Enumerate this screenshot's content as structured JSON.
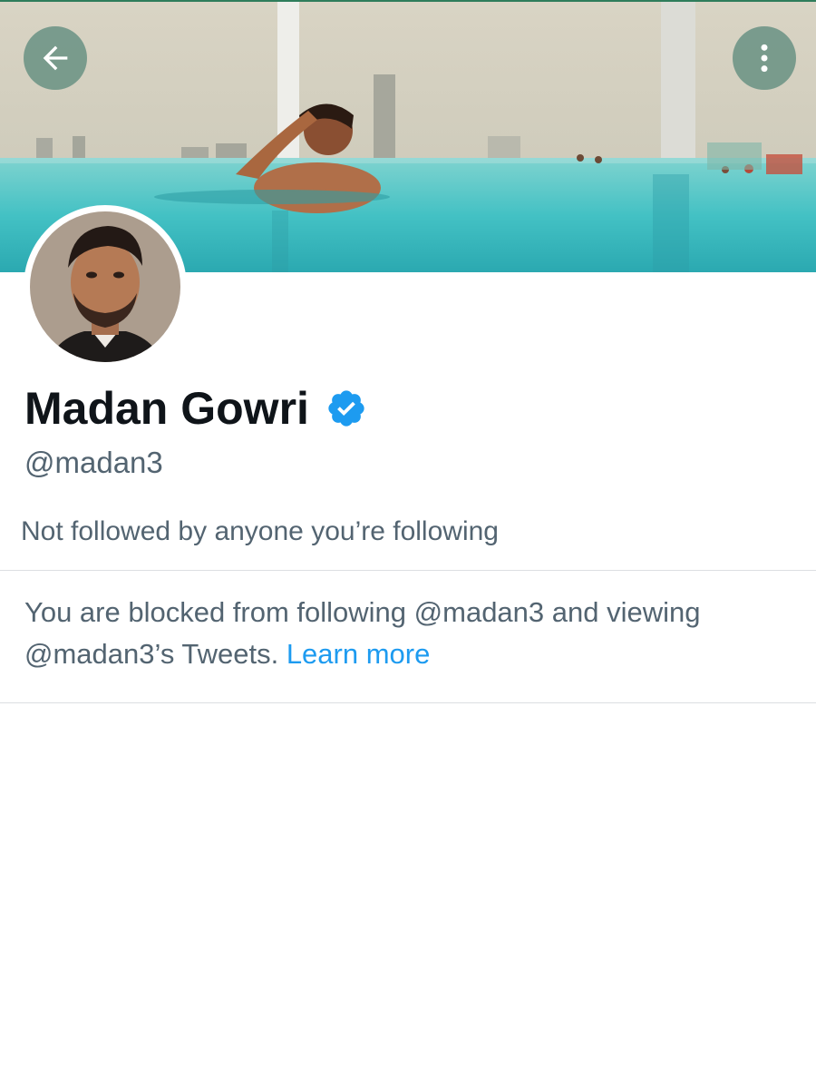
{
  "header": {
    "back_icon": "arrow-left-icon",
    "more_icon": "more-vertical-icon"
  },
  "profile": {
    "display_name": "Madan Gowri",
    "verified_icon": "verified-badge-icon",
    "handle": "@madan3",
    "followers_note": "Not followed by anyone you’re following"
  },
  "blocked": {
    "message": "You are blocked from following @madan3 and viewing @madan3’s Tweets.",
    "link_label": "Learn more"
  },
  "colors": {
    "primary_text": "#0f1419",
    "secondary_text": "#536471",
    "link": "#1d9bf0",
    "verified": "#1d9bf0",
    "divider": "#dcdfe2"
  }
}
